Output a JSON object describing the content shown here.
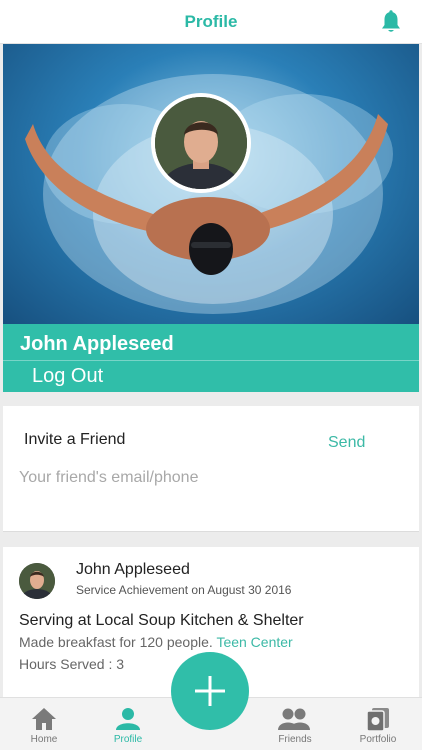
{
  "header": {
    "title": "Profile",
    "bell_icon": "bell-icon"
  },
  "profile": {
    "name": "John Appleseed",
    "logout_label": "Log Out"
  },
  "invite": {
    "title": "Invite a Friend",
    "send_label": "Send",
    "placeholder": "Your friend's email/phone"
  },
  "feed": {
    "name": "John Appleseed",
    "subtitle": "Service Achievement on August 30 2016",
    "title": "Serving at Local Soup Kitchen & Shelter",
    "description": "Made breakfast for 120 people.",
    "link": "Teen Center",
    "hours": "Hours Served : 3"
  },
  "tabs": [
    {
      "label": "Home",
      "icon": "home-icon"
    },
    {
      "label": "Profile",
      "icon": "person-icon",
      "active": true
    },
    {
      "label": "Friends",
      "icon": "friends-icon"
    },
    {
      "label": "Portfolio",
      "icon": "portfolio-icon"
    }
  ],
  "fab": {
    "icon": "plus-icon"
  },
  "colors": {
    "accent": "#30bea9",
    "accent_text": "#2bb9a6",
    "tab_inactive": "#777777"
  }
}
